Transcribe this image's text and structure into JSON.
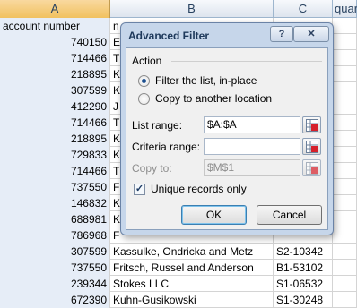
{
  "columns": [
    "A",
    "B",
    "C",
    "quar"
  ],
  "header_row": {
    "a": "account number",
    "b": "n",
    "c": ""
  },
  "rows": [
    {
      "a": "740150",
      "b": "E",
      "c": ""
    },
    {
      "a": "714466",
      "b": "T",
      "c": ""
    },
    {
      "a": "218895",
      "b": "K",
      "c": ""
    },
    {
      "a": "307599",
      "b": "K",
      "c": ""
    },
    {
      "a": "412290",
      "b": "J",
      "c": ""
    },
    {
      "a": "714466",
      "b": "T",
      "c": ""
    },
    {
      "a": "218895",
      "b": "K",
      "c": ""
    },
    {
      "a": "729833",
      "b": "K",
      "c": ""
    },
    {
      "a": "714466",
      "b": "T",
      "c": ""
    },
    {
      "a": "737550",
      "b": "F",
      "c": ""
    },
    {
      "a": "146832",
      "b": "K",
      "c": ""
    },
    {
      "a": "688981",
      "b": "K",
      "c": ""
    },
    {
      "a": "786968",
      "b": "F",
      "c": ""
    },
    {
      "a": "307599",
      "b": "Kassulke, Ondricka and Metz",
      "c": "S2-10342"
    },
    {
      "a": "737550",
      "b": "Fritsch, Russel and Anderson",
      "c": "B1-53102"
    },
    {
      "a": "239344",
      "b": "Stokes LLC",
      "c": "S1-06532"
    },
    {
      "a": "672390",
      "b": "Kuhn-Gusikowski",
      "c": "S1-30248"
    }
  ],
  "dialog": {
    "title": "Advanced Filter",
    "help_glyph": "?",
    "close_glyph": "✕",
    "action_label": "Action",
    "radio_filter_inplace": "Filter the list, in-place",
    "radio_copy_location": "Copy to another location",
    "list_range_label": "List range:",
    "list_range_value": "$A:$A",
    "criteria_range_label": "Criteria range:",
    "criteria_range_value": "",
    "copy_to_label": "Copy to:",
    "copy_to_value": "$M$1",
    "unique_records_label": "Unique records only",
    "unique_records_checked": true,
    "ok_label": "OK",
    "cancel_label": "Cancel",
    "selected_action": "filter_in_place"
  },
  "colors": {
    "selected_column_header": "#f1c15f",
    "dialog_frame": "#c6d6ea",
    "title_text": "#1e395b"
  }
}
